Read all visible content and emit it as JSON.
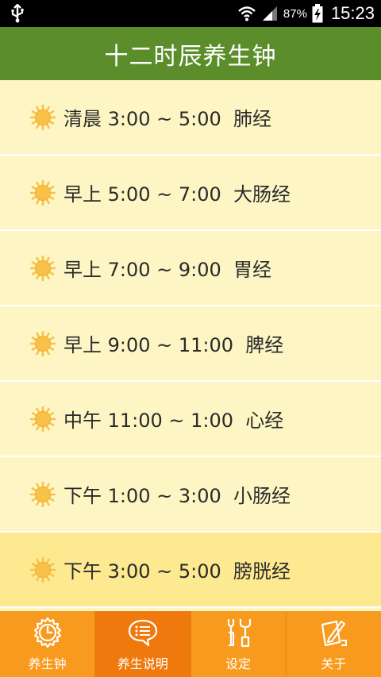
{
  "status_bar": {
    "battery_percent": "87%",
    "time": "15:23",
    "icons": [
      "usb-icon",
      "wifi-icon",
      "signal-icon",
      "battery-charging-icon"
    ]
  },
  "header": {
    "title": "十二时辰养生钟"
  },
  "list": {
    "items": [
      {
        "label": "清晨 3:00 ~ 5:00  肺经",
        "icon": "sun-icon",
        "active": false
      },
      {
        "label": "早上 5:00 ~ 7:00  大肠经",
        "icon": "sun-icon",
        "active": false
      },
      {
        "label": "早上 7:00 ~ 9:00  胃经",
        "icon": "sun-icon",
        "active": false
      },
      {
        "label": "早上 9:00 ~ 11:00  脾经",
        "icon": "sun-icon",
        "active": false
      },
      {
        "label": "中午 11:00 ~ 1:00  心经",
        "icon": "sun-icon",
        "active": false
      },
      {
        "label": "下午 1:00 ~ 3:00  小肠经",
        "icon": "sun-icon",
        "active": false
      },
      {
        "label": "下午 3:00 ~ 5:00  膀胱经",
        "icon": "sun-icon",
        "active": true
      }
    ]
  },
  "bottom_nav": {
    "items": [
      {
        "label": "养生钟",
        "icon": "alarm-clock-icon",
        "selected": false
      },
      {
        "label": "养生说明",
        "icon": "chat-bubble-icon",
        "selected": true
      },
      {
        "label": "设定",
        "icon": "tools-icon",
        "selected": false
      },
      {
        "label": "关于",
        "icon": "note-pencil-icon",
        "selected": false
      }
    ]
  },
  "colors": {
    "header_green": "#5b8e2b",
    "list_bg": "#fdf6c4",
    "list_active_bg": "#fde98f",
    "nav_orange": "#f79a1e",
    "nav_selected": "#f0790e",
    "sun": "#f8c24a"
  }
}
